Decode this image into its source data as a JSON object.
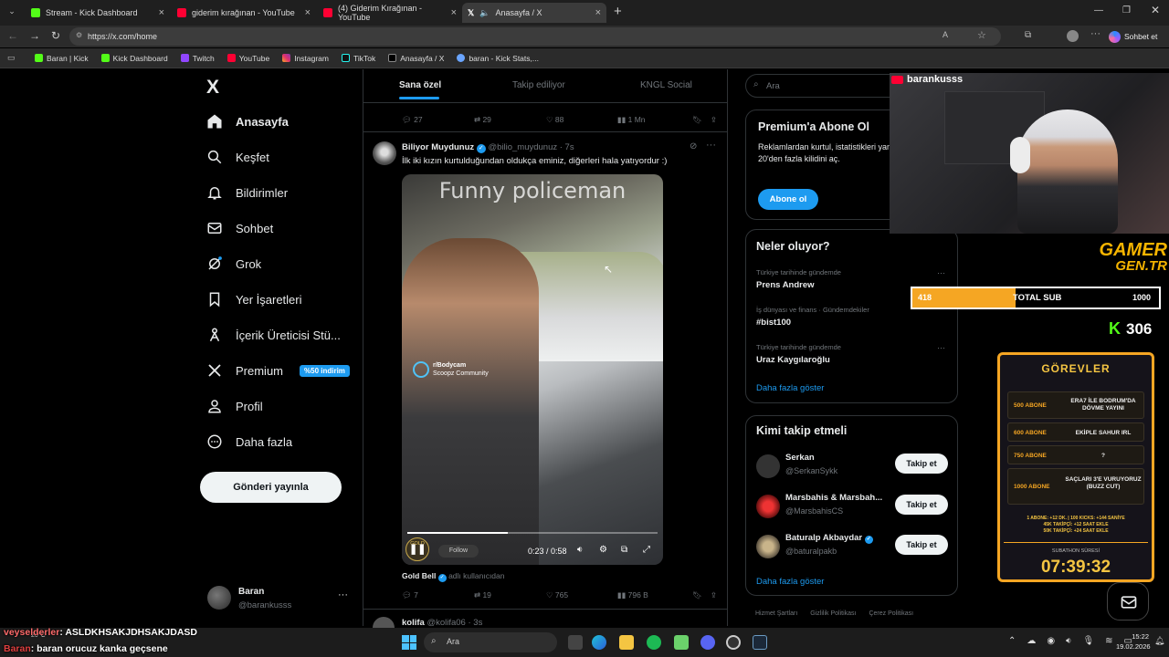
{
  "browser": {
    "tabs": [
      {
        "title": "Stream - Kick Dashboard",
        "color": "#53fc18"
      },
      {
        "title": "giderim kırağınan - YouTube",
        "color": "#ff0033"
      },
      {
        "title": "(4) Giderim Kırağınan - YouTube",
        "color": "#ff0033"
      },
      {
        "title": "Anasayfa / X",
        "color": "#ffffff"
      }
    ],
    "new_tab": "+",
    "url": "https://x.com/home",
    "copilot_label": "Sohbet et",
    "bookmarks": [
      "Baran | Kick",
      "Kick Dashboard",
      "Twitch",
      "YouTube",
      "Instagram",
      "TikTok",
      "Anasayfa / X",
      "baran - Kick Stats,..."
    ]
  },
  "sidebar": {
    "logo": "X",
    "items": [
      {
        "label": "Anasayfa",
        "icon": "home-icon"
      },
      {
        "label": "Keşfet",
        "icon": "search-icon"
      },
      {
        "label": "Bildirimler",
        "icon": "bell-icon"
      },
      {
        "label": "Sohbet",
        "icon": "mail-icon"
      },
      {
        "label": "Grok",
        "icon": "grok-icon"
      },
      {
        "label": "Yer İşaretleri",
        "icon": "bookmark-icon"
      },
      {
        "label": "İçerik Üreticisi Stü...",
        "icon": "creator-icon"
      },
      {
        "label": "Premium",
        "icon": "x-icon"
      },
      {
        "label": "Profil",
        "icon": "person-icon"
      },
      {
        "label": "Daha fazla",
        "icon": "more-icon"
      }
    ],
    "premium_badge": "%50 indirim",
    "post_button": "Gönderi yayınla",
    "account": {
      "name": "Baran",
      "handle": "@barankusss",
      "menu": "···"
    }
  },
  "feed": {
    "tabs": [
      "Sana özel",
      "Takip ediliyor",
      "KNGL Social"
    ],
    "prev_stats": {
      "replies": "27",
      "reposts": "29",
      "likes": "88",
      "views": "1 Mn"
    },
    "post": {
      "author": "Biliyor Muydunuz",
      "handle": "@bilio_muydunuz · 7s",
      "text": "İlk iki kızın kurtulduğundan oldukça eminiz, diğerleri hala yatıyordur :)",
      "video_overlay_text": "Funny policeman",
      "watermark_title": "r/Bodycam",
      "watermark_sub": "Scoopz Community",
      "time": "0:23 / 0:58",
      "follow_label": "Follow",
      "gold_label": "GOLD",
      "attribution_name": "Gold Bell",
      "attribution_note": "adlı kullanıcıdan",
      "stats": {
        "replies": "7",
        "reposts": "19",
        "likes": "765",
        "views": "796 B"
      },
      "progress": 0.4
    },
    "next_post": {
      "author": "kolifa",
      "handle": "@kolifa06 · 3s"
    }
  },
  "right": {
    "search_placeholder": "Ara",
    "premium": {
      "title": "Premium'a Abone Ol",
      "text": "Reklamlardan kurtul, istatistikleri yanıtlarını öne çıkar ve 20'den fazla kilidini aç.",
      "button": "Abone ol"
    },
    "trends": {
      "title": "Neler oluyor?",
      "items": [
        {
          "category": "Türkiye tarihinde gündemde",
          "name": "Prens Andrew"
        },
        {
          "category": "İş dünyası ve finans · Gündemdekiler",
          "name": "#bist100"
        },
        {
          "category": "Türkiye tarihinde gündemde",
          "name": "Uraz Kaygılaroğlu"
        }
      ],
      "more": "Daha fazla göster"
    },
    "who_to_follow": {
      "title": "Kimi takip etmeli",
      "items": [
        {
          "name": "Serkan",
          "handle": "@SerkanSykk"
        },
        {
          "name": "Marsbahis & Marsbah...",
          "handle": "@MarsbahisCS"
        },
        {
          "name": "Baturalp Akbaydar",
          "handle": "@baturalpakb"
        }
      ],
      "follow_label": "Takip et",
      "more": "Daha fazla göster"
    },
    "footer": [
      "Hizmet Şartları",
      "Gizlilik Politikası",
      "Çerez Politikası"
    ]
  },
  "overlay": {
    "channel": "barankusss",
    "brand_top": "GAMER",
    "brand_bottom": "GEN.TR",
    "sub_current": "418",
    "sub_label": "TOTAL SUB",
    "sub_target": "1000",
    "sub_progress": 0.418,
    "kick_count": "306",
    "gorevler_title": "GÖREVLER",
    "tasks": [
      {
        "count": "500 ABONE",
        "text": "ERA7 İLE BODRUM'DA DÖVME YAYINI"
      },
      {
        "count": "600 ABONE",
        "text": "EKİPLE SAHUR IRL"
      },
      {
        "count": "750 ABONE",
        "text": "?"
      },
      {
        "count": "1000 ABONE",
        "text": "SAÇLARI 3'E VURUYORUZ (BUZZ CUT)"
      }
    ],
    "rules": [
      "1 ABONE: +12 DK. | 100 KICKS: +144 SANİYE",
      "45K TAKİPÇİ: +12 SAAT EKLE",
      "50K TAKİPÇİ: +24 SAAT EKLE"
    ],
    "timer_label": "SUBATHON SÜRESİ",
    "timer": "07:39:32",
    "chat": [
      {
        "user": "veyselderler",
        "message": ": ASLDKHSAKJDHSAKJDASD",
        "color": "#ff6b6b"
      },
      {
        "user": "Baran",
        "message": ": baran orucuz kanka geçsene",
        "color": "#e04040"
      }
    ]
  },
  "taskbar": {
    "weather": "20°C",
    "search_placeholder": "Ara",
    "time": "15:22",
    "date": "19.02.2026"
  }
}
